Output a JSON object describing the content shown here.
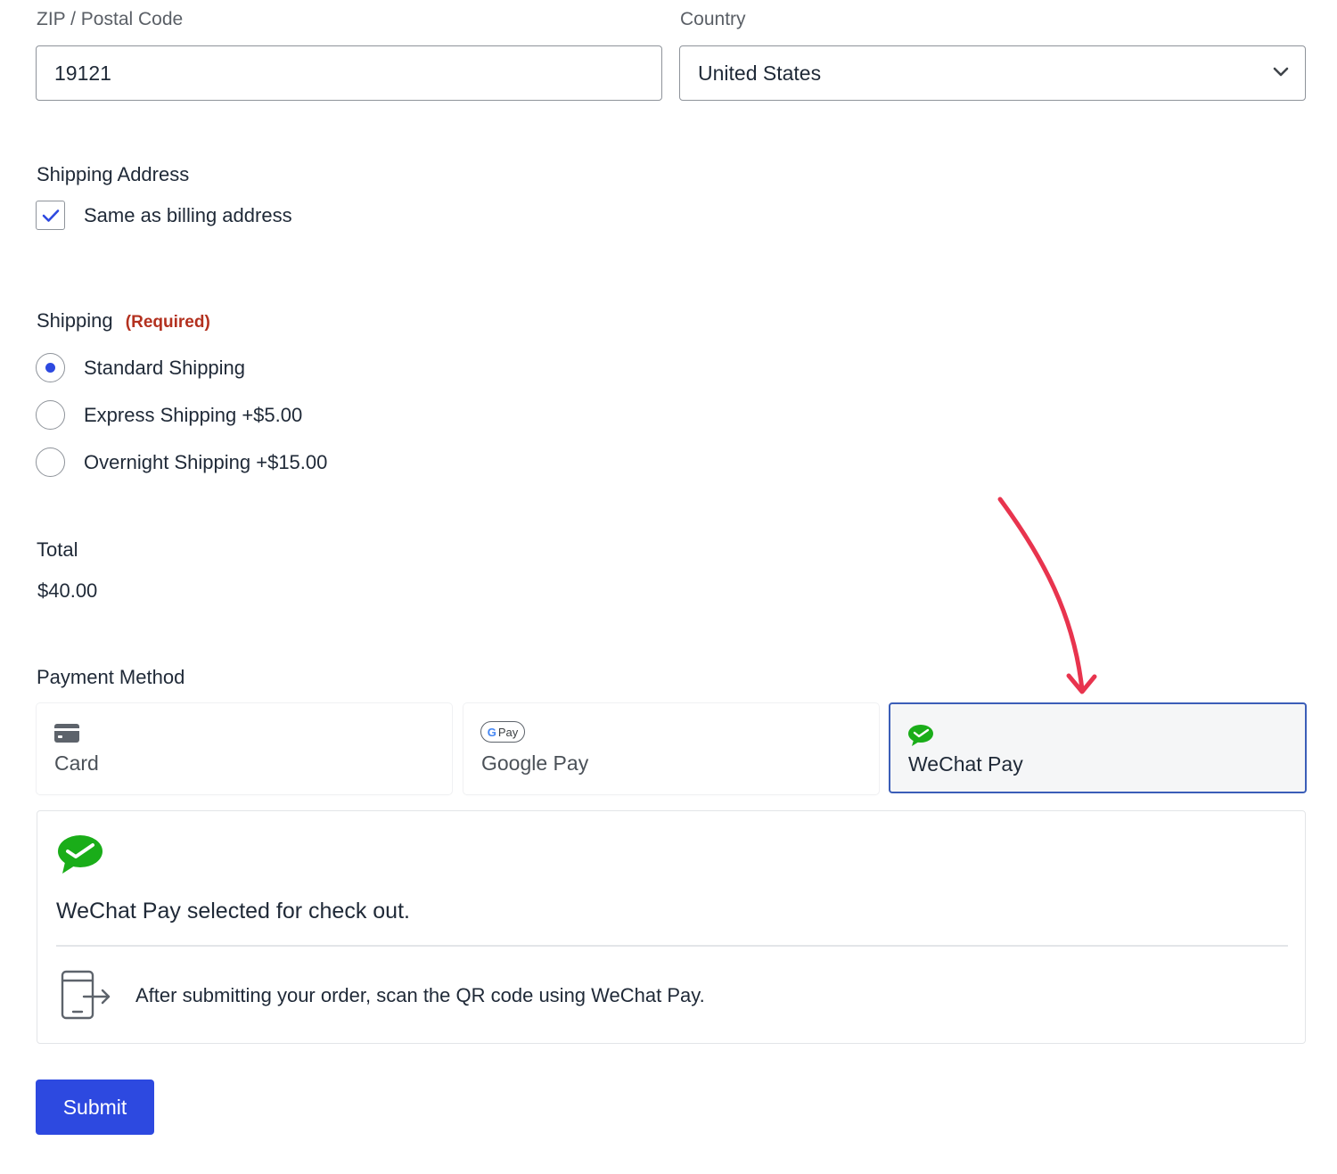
{
  "zip": {
    "label": "ZIP / Postal Code",
    "value": "19121"
  },
  "country": {
    "label": "Country",
    "value": "United States"
  },
  "shipping_address": {
    "title": "Shipping Address",
    "same_as_billing_label": "Same as billing address",
    "same_as_billing_checked": true
  },
  "shipping": {
    "title": "Shipping",
    "required_label": "(Required)",
    "options": [
      {
        "label": "Standard Shipping",
        "selected": true
      },
      {
        "label": "Express Shipping +$5.00",
        "selected": false
      },
      {
        "label": "Overnight Shipping +$15.00",
        "selected": false
      }
    ]
  },
  "total": {
    "title": "Total",
    "amount": "$40.00"
  },
  "payment": {
    "title": "Payment Method",
    "methods": [
      {
        "label": "Card",
        "icon": "card-icon",
        "selected": false
      },
      {
        "label": "Google Pay",
        "icon": "google-pay-icon",
        "badge_text": "Pay",
        "selected": false
      },
      {
        "label": "WeChat Pay",
        "icon": "wechat-icon",
        "selected": true
      }
    ],
    "panel": {
      "selected_text": "WeChat Pay selected for check out.",
      "instruction": "After submitting your order, scan the QR code using WeChat Pay."
    }
  },
  "submit_label": "Submit",
  "colors": {
    "accent": "#2d49e0",
    "required": "#b3311f",
    "wechat_green": "#1aad19",
    "annotation_arrow": "#e8344e",
    "selected_border": "#3b5eb8"
  }
}
